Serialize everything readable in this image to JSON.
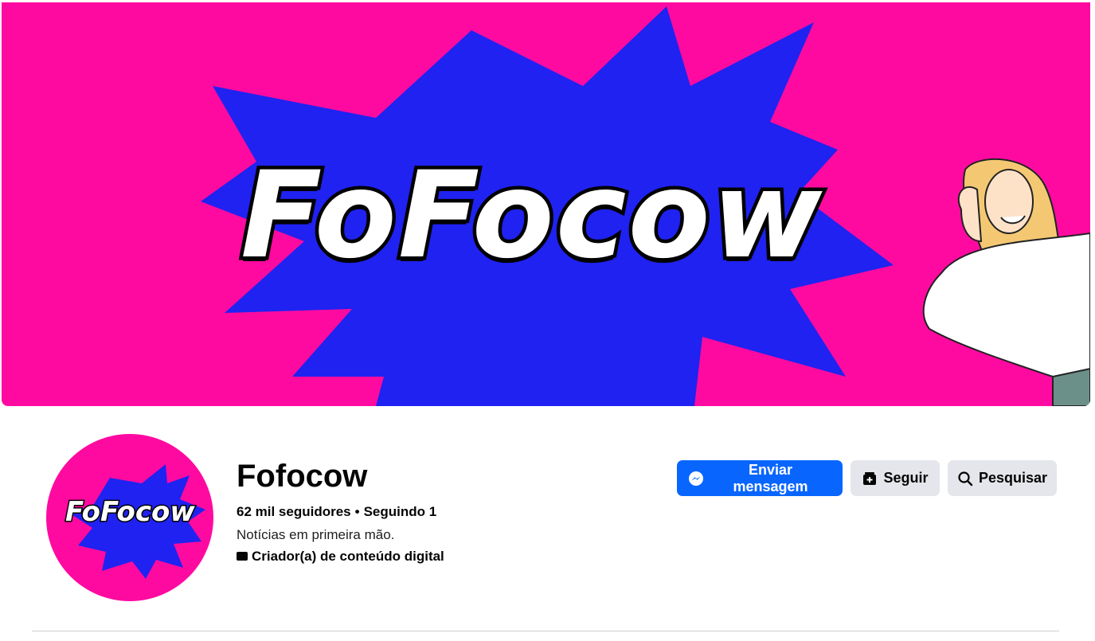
{
  "cover": {
    "brand_text": "FoFocow",
    "colors": {
      "background": "#ff0aa1",
      "burst": "#1f22f0"
    }
  },
  "avatar": {
    "brand_text": "FoFocow"
  },
  "profile": {
    "name": "Fofocow",
    "followers": "62 mil seguidores",
    "separator": "•",
    "following": "Seguindo 1",
    "bio": "Notícias em primeira mão.",
    "category": "Criador(a) de conteúdo digital",
    "category_icon": "category-briefcase-icon"
  },
  "actions": {
    "message_label": "Enviar mensagem",
    "message_icon": "messenger-icon",
    "follow_label": "Seguir",
    "follow_icon": "follow-icon",
    "search_label": "Pesquisar",
    "search_icon": "search-icon"
  },
  "colors": {
    "primary": "#0866ff",
    "secondary": "#e4e6eb",
    "text": "#050505"
  }
}
